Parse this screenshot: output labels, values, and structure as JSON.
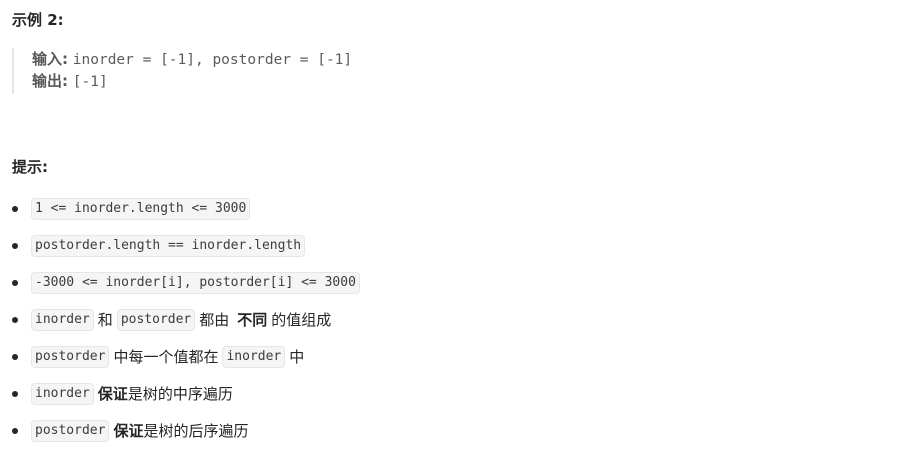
{
  "example": {
    "heading": "示例 2:",
    "input_label": "输入:",
    "input_value": "inorder = [-1], postorder = [-1]",
    "output_label": "输出:",
    "output_value": "[-1]"
  },
  "hints": {
    "heading": "提示:",
    "items": [
      {
        "code1": "1 <= inorder.length <= 3000"
      },
      {
        "code1": "postorder.length == inorder.length"
      },
      {
        "code1": "-3000 <= inorder[i], postorder[i] <= 3000"
      },
      {
        "code1": "inorder",
        "text1": "和",
        "code2": "postorder",
        "text2": "都由",
        "strong": "不同",
        "text3": "的值组成"
      },
      {
        "code1": "postorder",
        "text1": "中每一个值都在",
        "code2": "inorder",
        "text2": "中"
      },
      {
        "code1": "inorder",
        "strong": "保证",
        "text1": "是树的中序遍历"
      },
      {
        "code1": "postorder",
        "strong": "保证",
        "text1": "是树的后序遍历"
      }
    ]
  }
}
